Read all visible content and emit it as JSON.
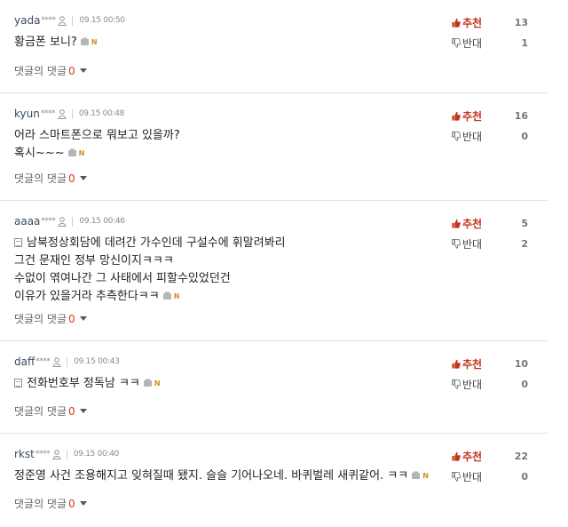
{
  "vote_labels": {
    "up": "추천",
    "down": "반대"
  },
  "reply_label": "댓글의 댓글",
  "comments": [
    {
      "author": "yada",
      "stars": "****",
      "date": "09.15 00:50",
      "lines": [
        "황금폰 보니?"
      ],
      "up": "13",
      "down": "1",
      "reply_count": "0"
    },
    {
      "author": "kyun",
      "stars": "****",
      "date": "09.15 00:48",
      "lines": [
        "어라 스마트폰으로 뭐보고 있을까?",
        "혹시~~~"
      ],
      "up": "16",
      "down": "0",
      "reply_count": "0"
    },
    {
      "author": "aaaa",
      "stars": "****",
      "date": "09.15 00:46",
      "lines": [
        "남북정상회담에 데려간 가수인데 구설수에 휘말려봐리",
        "그건 문재인 정부 망신이지ㅋㅋㅋ",
        "수없이 엮여나간 그 사태에서 피할수있었던건",
        "이유가 있을거라 추측한다ㅋㅋ"
      ],
      "up": "5",
      "down": "2",
      "reply_count": "0"
    },
    {
      "author": "daff",
      "stars": "****",
      "date": "09.15 00:43",
      "lines": [
        "전화번호부 정독남 ㅋㅋ"
      ],
      "up": "10",
      "down": "0",
      "reply_count": "0"
    },
    {
      "author": "rkst",
      "stars": "****",
      "date": "09.15 00:40",
      "lines": [
        "정준영 사건 조용해지고 잊혀질때 됐지. 슬슬 기어나오네. 바퀴벌레 새퀴같어. ㅋㅋ"
      ],
      "up": "22",
      "down": "0",
      "reply_count": "0"
    }
  ],
  "colors": {
    "upvote": "#c2331b",
    "reply_count": "#d1401a",
    "author": "#3b4a63",
    "new_badge": "#d38a1c"
  },
  "icons": {
    "user": "user-icon",
    "mobile": "mobile-icon",
    "new": "new-badge",
    "doc": "document-icon",
    "thumb_up": "thumb-up-icon",
    "thumb_down": "thumb-down-icon"
  },
  "new_badge_text": "N"
}
